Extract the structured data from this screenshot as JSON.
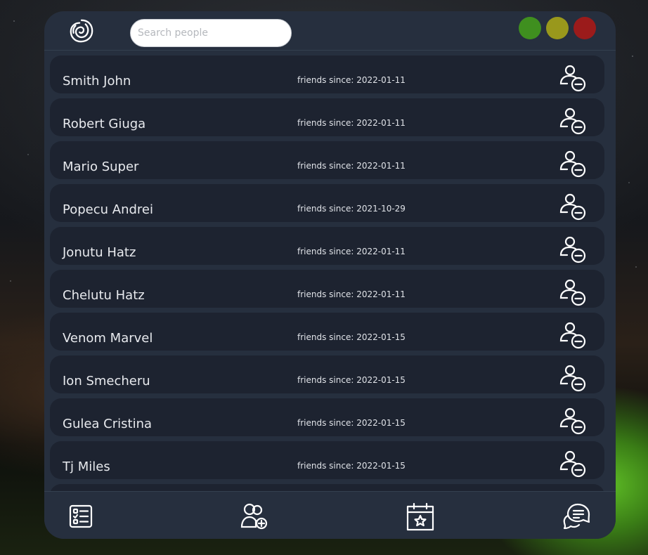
{
  "search": {
    "placeholder": "Search people"
  },
  "window_controls": {
    "colors": {
      "minimize": "#3f8f1f",
      "maximize": "#99981c",
      "close": "#9b1b1b"
    }
  },
  "icons": {
    "logo": "spiral-logo-icon",
    "remove_friend": "remove-friend-icon",
    "nav": [
      "list-icon",
      "add-friend-icon",
      "calendar-star-icon",
      "chat-icon"
    ]
  },
  "friends": [
    {
      "name": "Smith John",
      "since": "friends since: 2022-01-11"
    },
    {
      "name": "Robert Giuga",
      "since": "friends since: 2022-01-11"
    },
    {
      "name": "Mario Super",
      "since": "friends since: 2022-01-11"
    },
    {
      "name": "Popecu Andrei",
      "since": "friends since: 2021-10-29"
    },
    {
      "name": "Jonutu Hatz",
      "since": "friends since: 2022-01-11"
    },
    {
      "name": "Chelutu Hatz",
      "since": "friends since: 2022-01-11"
    },
    {
      "name": "Venom Marvel",
      "since": "friends since: 2022-01-15"
    },
    {
      "name": "Ion Smecheru",
      "since": "friends since: 2022-01-15"
    },
    {
      "name": "Gulea Cristina",
      "since": "friends since: 2022-01-15"
    },
    {
      "name": "Tj Miles",
      "since": "friends since: 2022-01-15"
    }
  ],
  "theme": {
    "panel": "#262f3e",
    "row": "#1d2330",
    "text": "#e8eaee"
  }
}
